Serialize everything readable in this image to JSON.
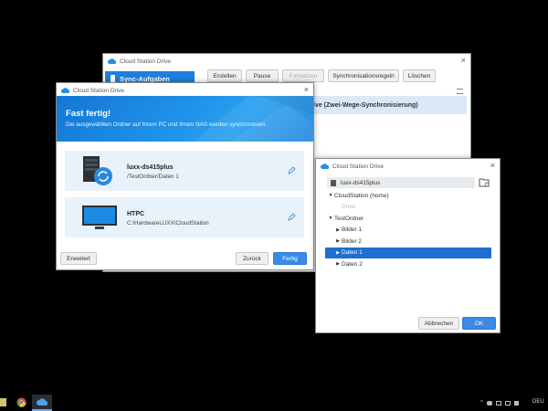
{
  "main_window": {
    "title": "Cloud Station Drive",
    "sidebar_selected": "Sync-Aufgaben",
    "toolbar": {
      "create": "Erstellen",
      "pause": "Pause",
      "resume": "Fortsetzen",
      "sync_rules": "Synchronisationsregeln",
      "delete": "Löschen"
    },
    "task_text": "ive (Zwei-Wege-Synchronisierung)"
  },
  "wizard": {
    "title": "Cloud Station Drive",
    "header_title": "Fast fertig!",
    "header_subtitle": "Die ausgewählten Ordner auf Ihrem PC und Ihrem NAS werden synchronisiert.",
    "nas": {
      "name": "luxx-ds415plus",
      "path": "/TestOrdner/Daten 1"
    },
    "pc": {
      "name": "HTPC",
      "path": "C:\\HardwareLUXX\\CloudStation"
    },
    "advanced": "Erweitert",
    "back": "Zurück",
    "finish": "Fertig"
  },
  "folder_dialog": {
    "title": "Cloud Station Drive",
    "server": "luxx-ds415plus",
    "tree": [
      {
        "label": "CloudStation (home)",
        "expanded": true,
        "selected": false,
        "disabled": false
      },
      {
        "label": "Drive",
        "expanded": false,
        "selected": false,
        "disabled": true
      },
      {
        "label": "TestOrdner",
        "expanded": true,
        "selected": false,
        "disabled": false
      },
      {
        "label": "Bilder 1",
        "expanded": false,
        "selected": false,
        "disabled": false
      },
      {
        "label": "Bilder 2",
        "expanded": false,
        "selected": false,
        "disabled": false
      },
      {
        "label": "Daten 1",
        "expanded": false,
        "selected": true,
        "disabled": false
      },
      {
        "label": "Daten 2",
        "expanded": false,
        "selected": false,
        "disabled": false
      }
    ],
    "cancel": "Abbrechen",
    "ok": "OK"
  },
  "taskbar": {
    "language": "DEU"
  },
  "colors": {
    "accent": "#1e88e5",
    "header_blue": "#1a8ae0",
    "card_bg": "#e8f2fb",
    "selection": "#1f6fd0"
  }
}
